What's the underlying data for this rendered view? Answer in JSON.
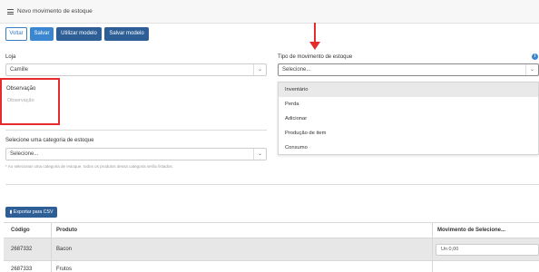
{
  "header": {
    "title": "Novo movimento de estoque"
  },
  "toolbar": {
    "voltar": "Voltar",
    "salvar": "Salvar",
    "utilizar_modelo": "Utilizar modelo",
    "salvar_modelo": "Salvar modelo"
  },
  "loja": {
    "label": "Loja",
    "value": "Camille"
  },
  "tipo": {
    "label": "Tipo de movimento de estoque",
    "value": "Selecione...",
    "options": [
      "Inventário",
      "Perda",
      "Adicionar",
      "Produção de item",
      "Consumo"
    ],
    "highlighted_index": 0
  },
  "observacao": {
    "label": "Observação",
    "placeholder": "Observação"
  },
  "categoria": {
    "label": "Selecione uma categoria de estoque",
    "value": "Selecione...",
    "hint": "* Ao selecionar uma categoria de estoque, todos os produtos dessa categoria serão listados."
  },
  "export_csv": "Exportar para CSV",
  "table": {
    "columns": [
      "Código",
      "Produto",
      "Movimento de Selecione..."
    ],
    "rows": [
      {
        "codigo": "2687332",
        "produto": "Bacon",
        "movimento": "Un 0,00"
      },
      {
        "codigo": "2687333",
        "produto": "Frutos",
        "movimento": ""
      }
    ]
  },
  "icons": {
    "menu": "menu-icon",
    "chevron": "chevron-down-icon",
    "info": "info-icon",
    "export": "bar-chart-icon"
  },
  "colors": {
    "primary": "#3a86d1",
    "dark_button": "#2d5f96",
    "annotation": "#e52b2b",
    "highlight_row": "#e7e7e7"
  }
}
